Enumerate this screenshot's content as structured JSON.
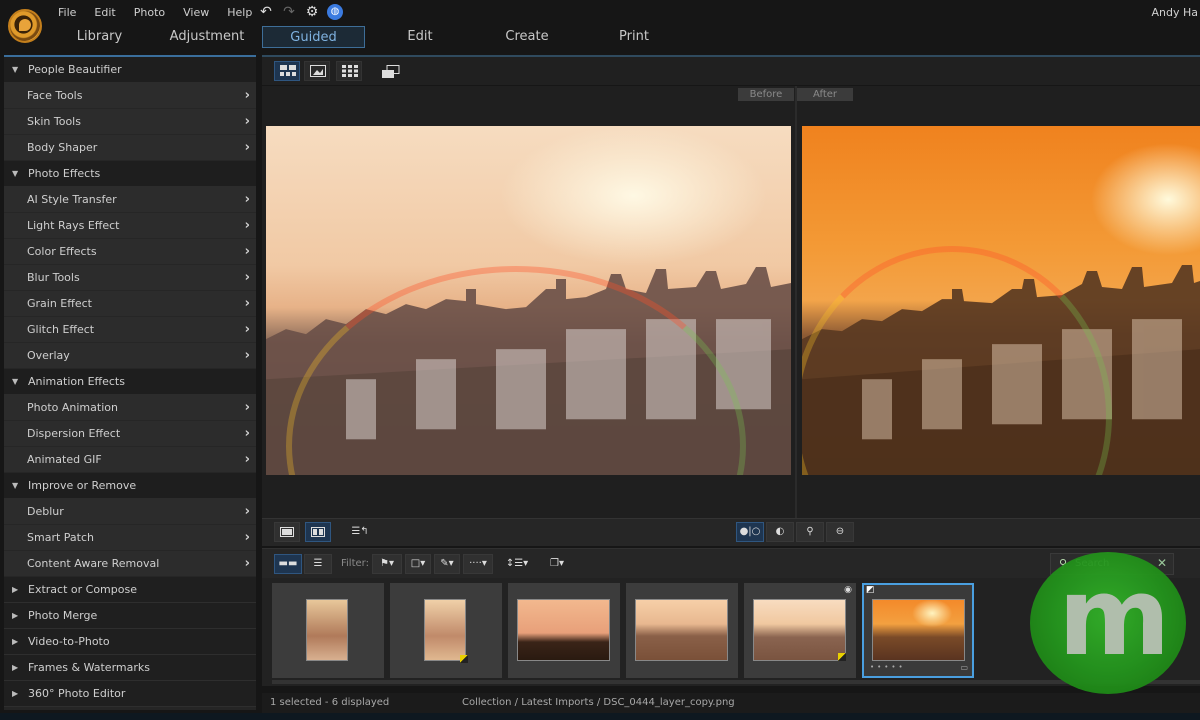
{
  "app": {
    "menu": [
      "File",
      "Edit",
      "Photo",
      "View",
      "Help"
    ],
    "user": "Andy Ha",
    "quick_icons": [
      "undo-icon",
      "redo-icon",
      "settings-icon",
      "notification-icon"
    ]
  },
  "tabs": [
    {
      "label": "Library",
      "active": false
    },
    {
      "label": "Adjustment",
      "active": false
    },
    {
      "label": "Guided",
      "active": true
    },
    {
      "label": "Edit",
      "active": false
    },
    {
      "label": "Create",
      "active": false
    },
    {
      "label": "Print",
      "active": false
    }
  ],
  "sidebar": {
    "groups": [
      {
        "label": "People Beautifier",
        "expanded": true,
        "items": [
          "Face Tools",
          "Skin Tools",
          "Body Shaper"
        ]
      },
      {
        "label": "Photo Effects",
        "expanded": true,
        "items": [
          "AI Style Transfer",
          "Light Rays Effect",
          "Color Effects",
          "Blur Tools",
          "Grain Effect",
          "Glitch Effect",
          "Overlay"
        ]
      },
      {
        "label": "Animation Effects",
        "expanded": true,
        "items": [
          "Photo Animation",
          "Dispersion Effect",
          "Animated GIF"
        ]
      },
      {
        "label": "Improve or Remove",
        "expanded": true,
        "items": [
          "Deblur",
          "Smart Patch",
          "Content Aware Removal"
        ]
      },
      {
        "label": "Extract or Compose",
        "expanded": false,
        "items": []
      },
      {
        "label": "Photo Merge",
        "expanded": false,
        "items": []
      },
      {
        "label": "Video-to-Photo",
        "expanded": false,
        "items": []
      },
      {
        "label": "Frames & Watermarks",
        "expanded": false,
        "items": []
      },
      {
        "label": "360° Photo Editor",
        "expanded": false,
        "items": []
      }
    ]
  },
  "viewer": {
    "before_label": "Before",
    "after_label": "After",
    "view_modes": [
      "split-view-icon",
      "single-view-icon",
      "grid-view-icon",
      "compare-icon"
    ]
  },
  "filterbar": {
    "filter_label": "Filter:",
    "search_placeholder": "Search"
  },
  "filmstrip": {
    "thumbnails": [
      {
        "type": "portrait",
        "tone": "warm",
        "flag": false,
        "selected": false
      },
      {
        "type": "portrait",
        "tone": "warm",
        "flag": true,
        "selected": false
      },
      {
        "type": "landscape",
        "tone": "silhouette",
        "flag": false,
        "selected": false
      },
      {
        "type": "landscape",
        "tone": "warm",
        "flag": false,
        "selected": false
      },
      {
        "type": "landscape",
        "tone": "flare",
        "flag": true,
        "selected": false
      },
      {
        "type": "landscape",
        "tone": "orange",
        "flag": false,
        "selected": true
      }
    ]
  },
  "status": {
    "selection": "1 selected - 6 displayed",
    "path": "Collection / Latest Imports / DSC_0444_layer_copy.png"
  },
  "colors": {
    "accent": "#4a9fe0",
    "active_tab_text": "#7fb2e0",
    "flag": "#e8d000"
  },
  "watermark": "m"
}
